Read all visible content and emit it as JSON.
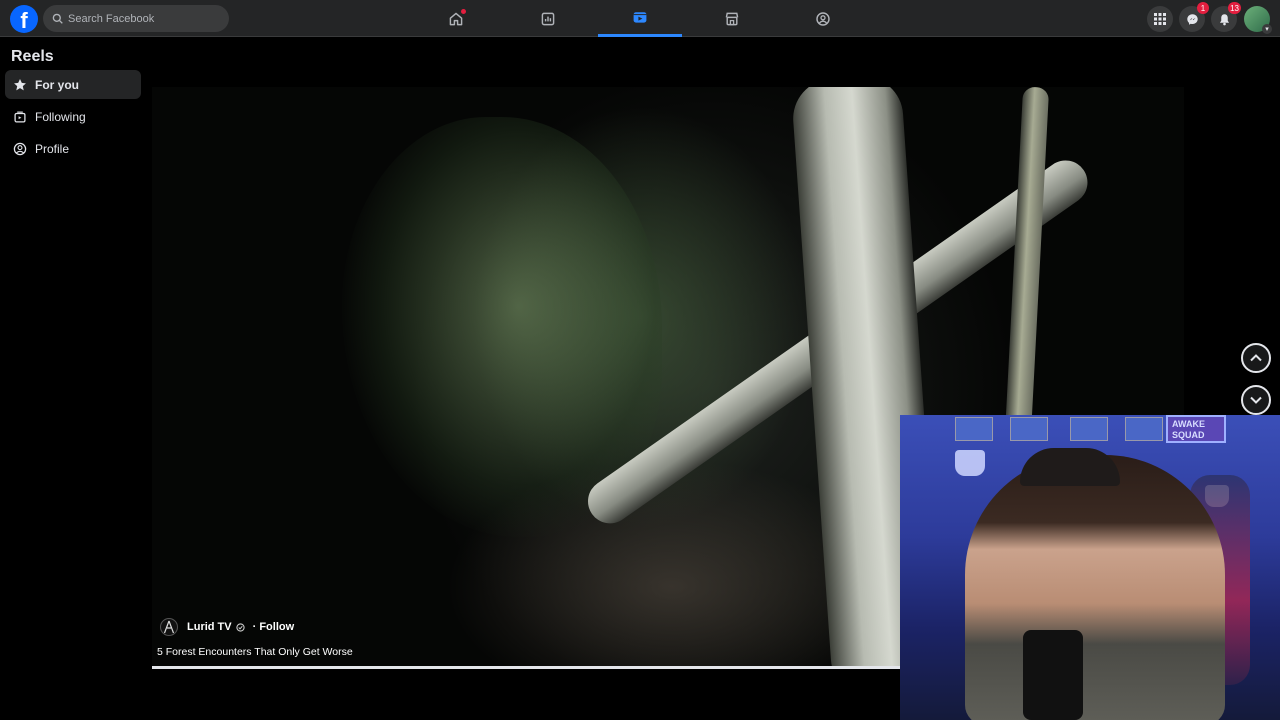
{
  "topbar": {
    "logo": "f",
    "search": {
      "placeholder": "Search Facebook",
      "value": ""
    },
    "nav_tabs": [
      {
        "name": "home",
        "icon": "home-icon",
        "active": false,
        "has_dot": true
      },
      {
        "name": "dashboard",
        "icon": "dashboard-icon",
        "active": false
      },
      {
        "name": "video",
        "icon": "video-icon",
        "active": true
      },
      {
        "name": "marketplace",
        "icon": "marketplace-icon",
        "active": false
      },
      {
        "name": "groups",
        "icon": "groups-icon",
        "active": false
      }
    ],
    "messenger_badge": "1",
    "notifications_badge": "13"
  },
  "sidebar": {
    "title": "Reels",
    "items": [
      {
        "label": "For you",
        "icon": "star-icon",
        "active": true
      },
      {
        "label": "Following",
        "icon": "following-icon",
        "active": false
      },
      {
        "label": "Profile",
        "icon": "profile-icon",
        "active": false
      }
    ]
  },
  "reel": {
    "uploader": "Lurid TV",
    "follow_label": "· Follow",
    "caption": "5 Forest Encounters That Only Get Worse",
    "progress": 1.0
  },
  "webcam": {
    "sign_text": "AWAKE SQUAD"
  },
  "colors": {
    "accent": "#2d88ff",
    "topbar_bg": "#242526",
    "badge": "#e41e3f",
    "page_bg": "#000000"
  }
}
